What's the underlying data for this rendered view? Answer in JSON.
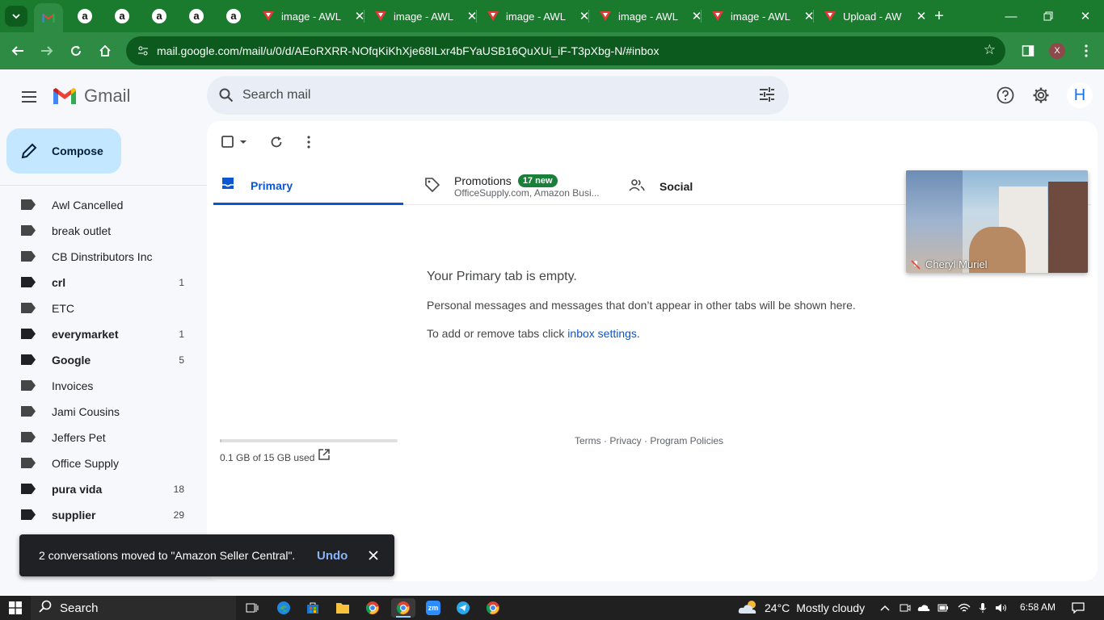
{
  "browser": {
    "tabs": [
      {
        "label": "",
        "favicon": "gmail-icon"
      },
      {
        "label": "",
        "favicon": "amazon-icon"
      },
      {
        "label": "",
        "favicon": "amazon-icon"
      },
      {
        "label": "",
        "favicon": "amazon-icon"
      },
      {
        "label": "",
        "favicon": "amazon-icon"
      },
      {
        "label": "",
        "favicon": "amazon-icon"
      },
      {
        "label": "image - AWL",
        "favicon": "awl-icon"
      },
      {
        "label": "image - AWL",
        "favicon": "awl-icon"
      },
      {
        "label": "image - AWL",
        "favicon": "awl-icon"
      },
      {
        "label": "image - AWL",
        "favicon": "awl-icon"
      },
      {
        "label": "image - AWL",
        "favicon": "awl-icon"
      },
      {
        "label": "Upload - AW",
        "favicon": "awl-icon"
      }
    ],
    "url": "mail.google.com/mail/u/0/d/AEoRXRR-NOfqKiKhXje68ILxr4bFYaUSB16QuXUi_iF-T3pXbg-N/#inbox",
    "profile_initial": "X",
    "accent_color": "#1a7a2e"
  },
  "gmail": {
    "logo_text": "Gmail",
    "search_placeholder": "Search mail",
    "avatar_initial": "H",
    "compose_label": "Compose",
    "labels": [
      {
        "name": "Awl Cancelled",
        "count": "",
        "bold": false
      },
      {
        "name": "break outlet",
        "count": "",
        "bold": false
      },
      {
        "name": "CB Dinstributors Inc",
        "count": "",
        "bold": false
      },
      {
        "name": "crl",
        "count": "1",
        "bold": true
      },
      {
        "name": "ETC",
        "count": "",
        "bold": false
      },
      {
        "name": "everymarket",
        "count": "1",
        "bold": true
      },
      {
        "name": "Google",
        "count": "5",
        "bold": true
      },
      {
        "name": "Invoices",
        "count": "",
        "bold": false
      },
      {
        "name": "Jami Cousins",
        "count": "",
        "bold": false
      },
      {
        "name": "Jeffers Pet",
        "count": "",
        "bold": false
      },
      {
        "name": "Office Supply",
        "count": "",
        "bold": false
      },
      {
        "name": "pura vida",
        "count": "18",
        "bold": true
      },
      {
        "name": "supplier",
        "count": "29",
        "bold": true
      }
    ],
    "inbox_tabs": {
      "primary": "Primary",
      "promotions": "Promotions",
      "promotions_badge": "17 new",
      "promotions_senders": "OfficeSupply.com, Amazon Busi...",
      "social": "Social"
    },
    "empty_state": {
      "title": "Your Primary tab is empty.",
      "description": "Personal messages and messages that don’t appear in other tabs will be shown here.",
      "hint_prefix": "To add or remove tabs click ",
      "hint_link": "inbox settings",
      "hint_suffix": "."
    },
    "storage": {
      "text": "0.1 GB of 15 GB used",
      "fraction": 0.007
    },
    "footer": "Terms · Privacy · Program Policies",
    "video_participant": "Cheryl Muriel",
    "snackbar": {
      "message": "2 conversations moved to \"Amazon Seller Central\".",
      "undo_label": "Undo"
    }
  },
  "taskbar": {
    "search_label": "Search",
    "weather_temp": "24°C",
    "weather_text": "Mostly cloudy",
    "time": "6:58 AM"
  }
}
